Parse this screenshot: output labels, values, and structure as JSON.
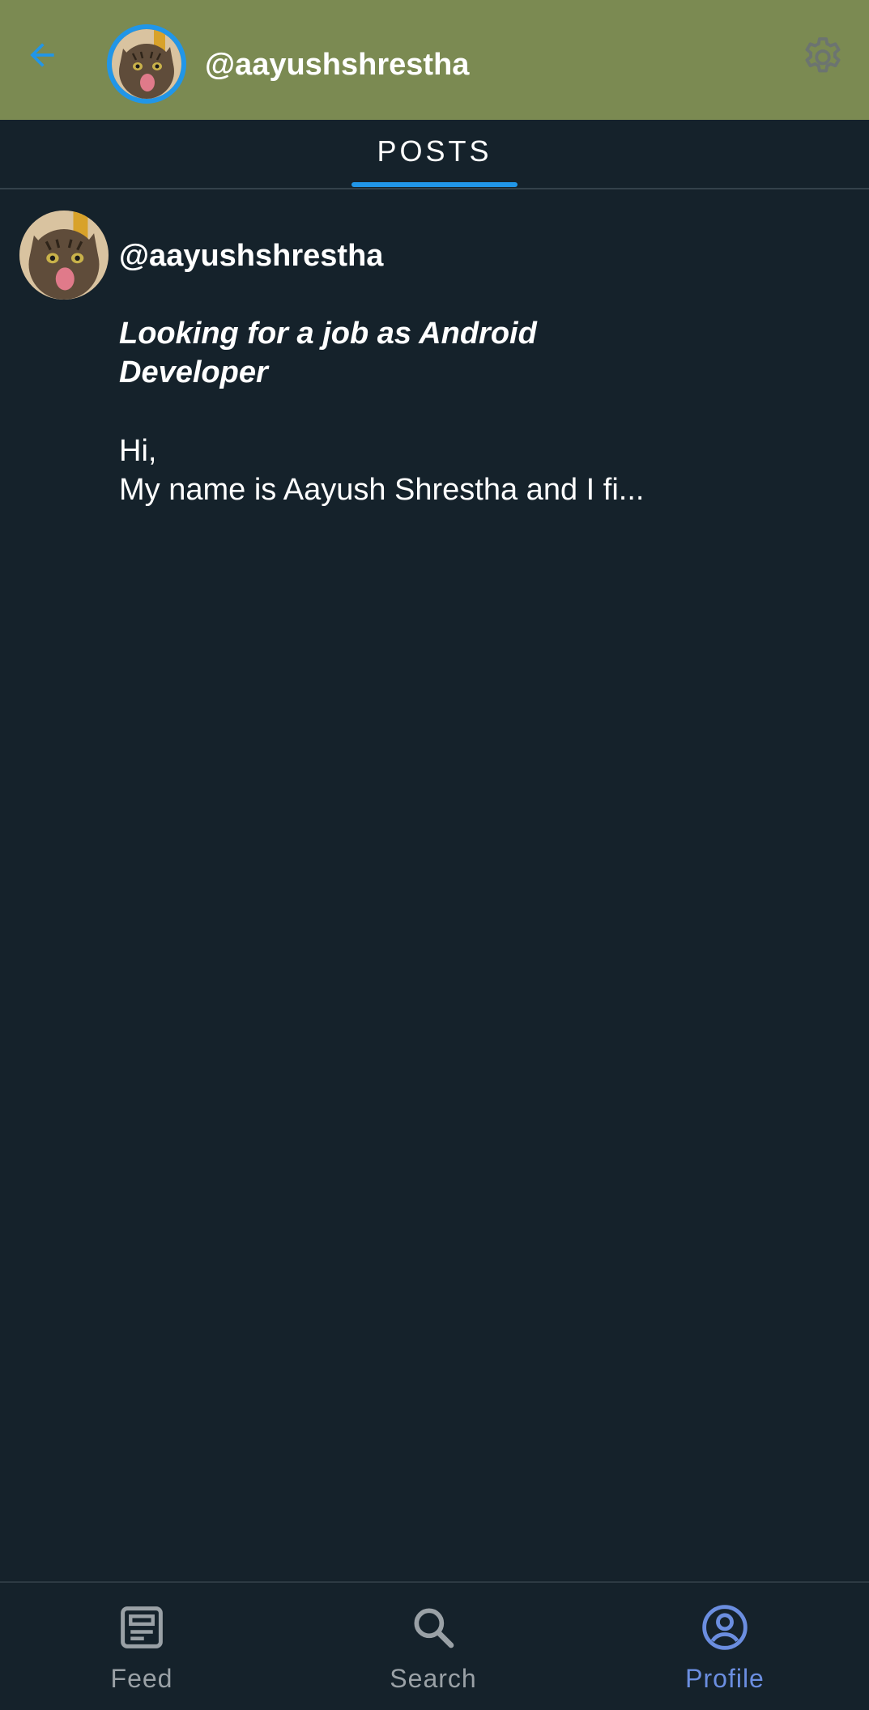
{
  "app_bar": {
    "username": "@aayushshrestha",
    "back_icon": "arrow-left-icon",
    "settings_icon": "gear-icon",
    "colors": {
      "background": "#7b8a52",
      "back_icon": "#2196e8",
      "avatar_ring": "#2196e8",
      "settings_icon": "#6c7470"
    }
  },
  "tabs": [
    {
      "label": "POSTS",
      "selected": true
    }
  ],
  "posts": [
    {
      "username": "@aayushshrestha",
      "title": "Looking for a job as Android Developer",
      "body": "Hi,\nMy name is Aayush Shrestha and I fi..."
    }
  ],
  "bottom_nav": {
    "items": [
      {
        "label": "Feed",
        "icon": "feed-icon",
        "selected": false
      },
      {
        "label": "Search",
        "icon": "search-icon",
        "selected": false
      },
      {
        "label": "Profile",
        "icon": "profile-icon",
        "selected": true
      }
    ],
    "colors": {
      "inactive": "#9aa1a6",
      "active": "#6b8ee0"
    }
  },
  "colors": {
    "page_background": "#15222b",
    "tab_indicator": "#2196e8"
  }
}
